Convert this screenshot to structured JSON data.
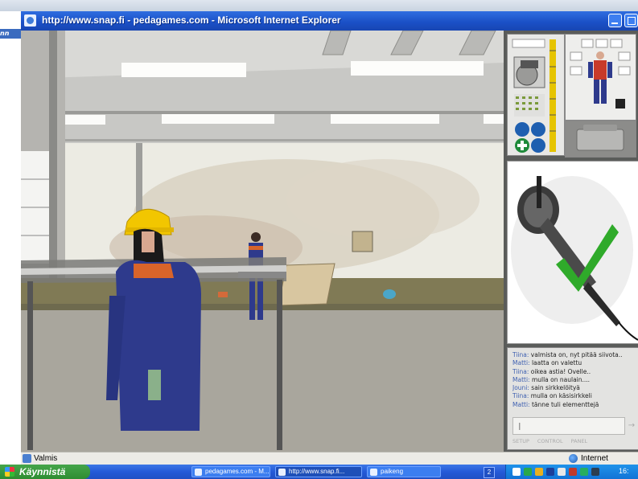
{
  "outer": {
    "left_tag": "nn"
  },
  "browser": {
    "title": "http://www.snap.fi - pedagames.com - Microsoft Internet Explorer",
    "status_text": "Valmis",
    "zone_text": "Internet"
  },
  "chat": {
    "lines": [
      {
        "speaker": "Tiina:",
        "text": " valmista on, nyt pitää siivota.."
      },
      {
        "speaker": "Matti:",
        "text": " laatta on valettu"
      },
      {
        "speaker": "Tiina:",
        "text": " oikea astia! Ovelle.."
      },
      {
        "speaker": "Matti:",
        "text": " mulla on naulain...."
      },
      {
        "speaker": "Jouni:",
        "text": " sain sirkkelöityä"
      },
      {
        "speaker": "Tiina:",
        "text": " mulla on käsisirkkeli"
      },
      {
        "speaker": "Matti:",
        "text": " tänne tuli elementtejä"
      }
    ],
    "cursor": "I",
    "send": "→",
    "tabs": [
      "SETUP",
      "CONTROL",
      "PANEL"
    ]
  },
  "taskbar": {
    "start_label": "Käynnistä",
    "tasks": [
      {
        "label": "pedagames.com - M..."
      },
      {
        "label": "http://www.snap.fi..."
      },
      {
        "label": "paikeng"
      }
    ],
    "tray_badge": "2",
    "clock": "16:"
  },
  "colors": {
    "titlebar": "#1a4fc5",
    "worker_suit": "#2e3a8c",
    "hardhat": "#f2c600",
    "check_mark": "#2faa2a",
    "side_panel": "#5a5c5a"
  },
  "icons": {
    "selected_tool": "angle-grinder-icon",
    "inventory_tool": "circular-saw-icon",
    "confirm": "green-check-icon"
  }
}
